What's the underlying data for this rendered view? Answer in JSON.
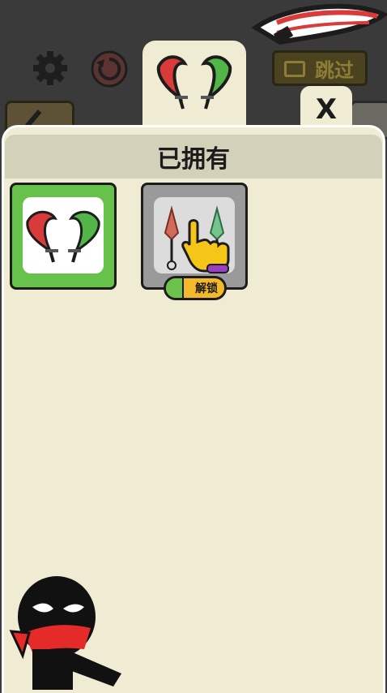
{
  "panel": {
    "title": "已拥有"
  },
  "buttons": {
    "skip_label": "跳过",
    "close_label": "X"
  },
  "items": [
    {
      "name": "red-green-blades",
      "status": "selected"
    },
    {
      "name": "red-green-kunai",
      "status": "locked",
      "action_label": "解锁"
    }
  ],
  "icons": [
    "gear-icon",
    "restart-icon",
    "video-icon",
    "close-icon",
    "hand-pointer-icon"
  ],
  "colors": {
    "panel_bg": "#f0ecd3",
    "selected_card": "#67c24c",
    "locked_card": "#9a9a9a",
    "unlock_button": "#f4b82b"
  }
}
